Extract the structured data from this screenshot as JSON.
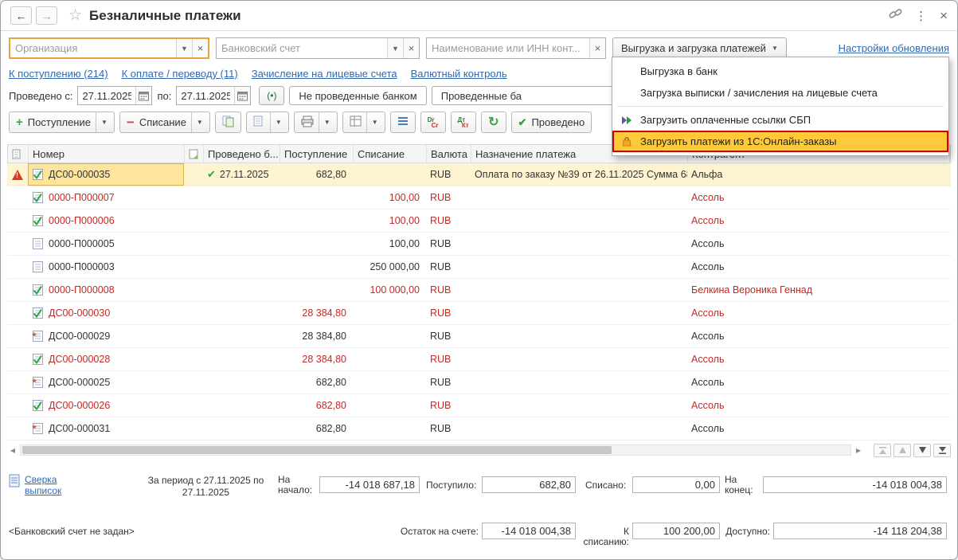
{
  "window": {
    "title": "Безналичные платежи"
  },
  "icons": {
    "back": "←",
    "forward": "→",
    "favorite": "☆",
    "more": "⋮",
    "close": "×",
    "caret": "▼",
    "clear": "×",
    "check": "✔",
    "refresh": "↻",
    "sort_asc": "↑",
    "star_mark": "*",
    "left": "◀",
    "right": "▶"
  },
  "filters": {
    "organization": {
      "placeholder": "Организация"
    },
    "bank_account": {
      "placeholder": "Банковский счет"
    },
    "counterparty": {
      "placeholder": "Наименование или ИНН конт..."
    },
    "upload_menu_button": "Выгрузка и загрузка платежей",
    "update_settings_link": "Настройки обновления"
  },
  "nav_links": [
    {
      "label": "К поступлению (214)"
    },
    {
      "label": "К оплате / переводу (11)"
    },
    {
      "label": "Зачисление на лицевые счета"
    },
    {
      "label": "Валютный контроль"
    }
  ],
  "period": {
    "from_label": "Проведено с:",
    "from_value": "27.11.2025",
    "to_label": "по:",
    "to_value": "27.11.2025",
    "range_button": "(•)",
    "not_posted_button": "Не проведенные банком",
    "posted_button": "Проведенные ба"
  },
  "toolbar": {
    "receipt_button": "Поступление",
    "writeoff_button": "Списание",
    "posted_button": "Проведено",
    "drcr_top": "Dr",
    "drcr_bottom": "Cr",
    "dtkt_top": "Дт",
    "dtkt_bottom": "Кт"
  },
  "dropdown_menu": {
    "items": [
      {
        "label": "Выгрузка в банк"
      },
      {
        "label": "Загрузка выписки / зачисления на лицевые счета"
      },
      {
        "label": "Загрузить оплаченные ссылки СБП"
      },
      {
        "label": "Загрузить платежи из 1С:Онлайн-заказы"
      }
    ]
  },
  "table": {
    "headers": {
      "number": "Номер",
      "posted": "Проведено б...",
      "receipt": "Поступление",
      "writeoff": "Списание",
      "currency": "Валюта",
      "purpose": "Назначение платежа",
      "counterparty": "Контрагент"
    },
    "rows": [
      {
        "warning": true,
        "selected": true,
        "icon": "check",
        "number": "ДС00-000035",
        "posted_date": "27.11.2025",
        "receipt": "682,80",
        "writeoff": "",
        "currency": "RUB",
        "purpose": "Оплата по заказу №39 от 26.11.2025 Сумма 68...",
        "counterparty": "Альфа",
        "red": false
      },
      {
        "icon": "check",
        "number": "0000-П000007",
        "receipt": "",
        "writeoff": "100,00",
        "currency": "RUB",
        "purpose": "",
        "counterparty": "Ассоль",
        "red": true
      },
      {
        "icon": "check",
        "number": "0000-П000006",
        "receipt": "",
        "writeoff": "100,00",
        "currency": "RUB",
        "purpose": "",
        "counterparty": "Ассоль",
        "red": true
      },
      {
        "icon": "plain",
        "number": "0000-П000005",
        "receipt": "",
        "writeoff": "100,00",
        "currency": "RUB",
        "purpose": "",
        "counterparty": "Ассоль",
        "red": false
      },
      {
        "icon": "plain",
        "number": "0000-П000003",
        "receipt": "",
        "writeoff": "250 000,00",
        "currency": "RUB",
        "purpose": "",
        "counterparty": "Ассоль",
        "red": false
      },
      {
        "icon": "check",
        "number": "0000-П000008",
        "receipt": "",
        "writeoff": "100 000,00",
        "currency": "RUB",
        "purpose": "",
        "counterparty": "Белкина Вероника Геннад",
        "red": true
      },
      {
        "icon": "check",
        "number": "ДС00-000030",
        "receipt": "28 384,80",
        "writeoff": "",
        "currency": "RUB",
        "purpose": "",
        "counterparty": "Ассоль",
        "red": true
      },
      {
        "icon": "star",
        "number": "ДС00-000029",
        "receipt": "28 384,80",
        "writeoff": "",
        "currency": "RUB",
        "purpose": "",
        "counterparty": "Ассоль",
        "red": false
      },
      {
        "icon": "check",
        "number": "ДС00-000028",
        "receipt": "28 384,80",
        "writeoff": "",
        "currency": "RUB",
        "purpose": "",
        "counterparty": "Ассоль",
        "red": true
      },
      {
        "icon": "star",
        "number": "ДС00-000025",
        "receipt": "682,80",
        "writeoff": "",
        "currency": "RUB",
        "purpose": "",
        "counterparty": "Ассоль",
        "red": false
      },
      {
        "icon": "check",
        "number": "ДС00-000026",
        "receipt": "682,80",
        "writeoff": "",
        "currency": "RUB",
        "purpose": "",
        "counterparty": "Ассоль",
        "red": true
      },
      {
        "icon": "star",
        "number": "ДС00-000031",
        "receipt": "682,80",
        "writeoff": "",
        "currency": "RUB",
        "purpose": "",
        "counterparty": "Ассоль",
        "red": false
      }
    ]
  },
  "summary": {
    "reconciliation_link": "Сверка выписок",
    "period_text": "За период с 27.11.2025 по 27.11.2025",
    "begin_label": "На начало:",
    "begin_value": "-14 018 687,18",
    "received_label": "Поступило:",
    "received_value": "682,80",
    "written_label": "Списано:",
    "written_value": "0,00",
    "end_label": "На конец:",
    "end_value": "-14 018 004,38"
  },
  "status": {
    "no_account_text": "<Банковский счет не задан>",
    "balance_label": "Остаток на счете:",
    "balance_value": "-14 018 004,38",
    "to_writeoff_label": "К списанию:",
    "to_writeoff_value": "100 200,00",
    "available_label": "Доступно:",
    "available_value": "-14 118 204,38"
  }
}
